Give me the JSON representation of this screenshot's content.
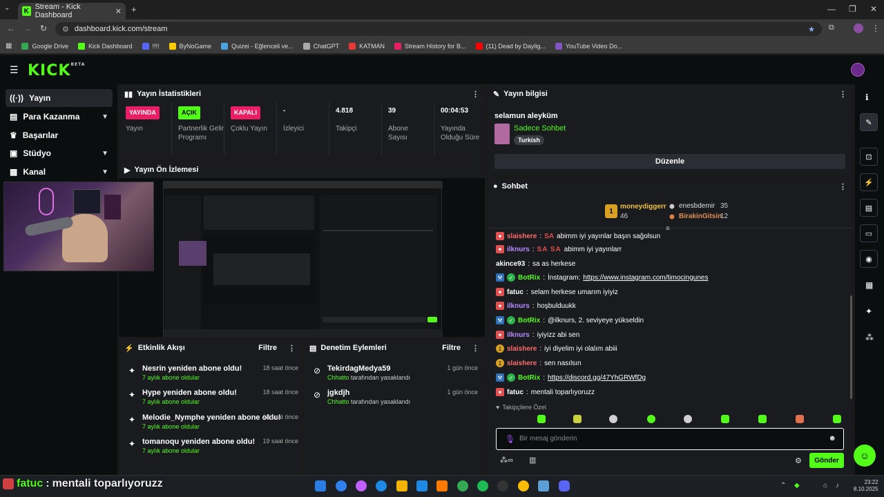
{
  "browser": {
    "tab_title": "Stream - Kick Dashboard",
    "url": "dashboard.kick.com/stream",
    "bookmarks": [
      {
        "label": "Google Drive",
        "color": "#34a853"
      },
      {
        "label": "Kick Dashboard",
        "color": "#53fc18"
      },
      {
        "label": "!!!!",
        "color": "#5865f2"
      },
      {
        "label": "ByNoGame",
        "color": "#ffcc00"
      },
      {
        "label": "Quizei - Eğlenceli ve...",
        "color": "#4aa3df"
      },
      {
        "label": "ChatGPT",
        "color": "#aaaaaa"
      },
      {
        "label": "KATMAN",
        "color": "#e53935"
      },
      {
        "label": "Stream History for B...",
        "color": "#e91e63"
      },
      {
        "label": "(11) Dead by Daylig...",
        "color": "#ff0000"
      },
      {
        "label": "YouTube Video Do...",
        "color": "#7e57c2"
      }
    ]
  },
  "header": {
    "logo": "KICK",
    "logo_sup": "BETA"
  },
  "sidebar": {
    "items": [
      {
        "label": "Yayın",
        "icon": "broadcast-icon"
      },
      {
        "label": "Para Kazanma",
        "icon": "wallet-icon"
      },
      {
        "label": "Başarılar",
        "icon": "trophy-icon"
      },
      {
        "label": "Stüdyo",
        "icon": "studio-icon"
      },
      {
        "label": "Kanal",
        "icon": "channel-icon"
      }
    ]
  },
  "stats": {
    "title": "Yayın İstatistikleri",
    "cols": [
      {
        "value": "YAYINDA",
        "label": "Yayın",
        "badge_color": "#e91e63"
      },
      {
        "value": "AÇIK",
        "label": "Partnerlik Gelir Programı",
        "badge_color": "#53fc18"
      },
      {
        "value": "KAPALI",
        "label": "Çoklu Yayın",
        "badge_color": "#e91e63"
      },
      {
        "value": "-",
        "label": "İzleyici"
      },
      {
        "value": "4.818",
        "label": "Takipçi"
      },
      {
        "value": "39",
        "label": "Abone Sayısı"
      },
      {
        "value": "00:04:53",
        "label": "Yayında Olduğu Süre"
      }
    ]
  },
  "preview": {
    "title": "Yayın Ön İzlemesi"
  },
  "info": {
    "title": "Yayın bilgisi",
    "stream_title": "selamun aleyküm",
    "category": "Sadece Sohbet",
    "tag": "Turkish",
    "edit_label": "Düzenle"
  },
  "events": {
    "title": "Etkinlik Akışı",
    "filter": "Filtre",
    "items": [
      {
        "title": "Nesrin yeniden abone oldu!",
        "sub": "7 aylık abone oldular",
        "time": "18 saat önce"
      },
      {
        "title": "Hype yeniden abone oldu!",
        "sub": "7 aylık abone oldular",
        "time": "18 saat önce"
      },
      {
        "title": "Melodie_Nymphe yeniden abone oldu!",
        "sub": "7 aylık abone oldular",
        "time": "18 saat önce"
      },
      {
        "title": "tomanoqu yeniden abone oldu!",
        "sub": "7 aylık abone oldular",
        "time": "19 saat önce"
      }
    ]
  },
  "mod": {
    "title": "Denetim Eylemleri",
    "filter": "Filtre",
    "items": [
      {
        "user": "TekirdagMedya59",
        "by": "Chhatto",
        "suffix": "tarafından yasaklandı",
        "time": "1 gün önce"
      },
      {
        "user": "jgkdjh",
        "by": "Chhatto",
        "suffix": "tarafından yasaklandı",
        "time": "1 gün önce"
      }
    ]
  },
  "chat": {
    "title": "Sohbet",
    "leaders": [
      {
        "name": "moneydiggerr",
        "count": "46"
      },
      {
        "name": "enesbdemir",
        "count": "35"
      },
      {
        "name": "BirakinGitsin",
        "count": "12"
      }
    ],
    "messages": [
      {
        "user": "slaishere",
        "color": "#ff6b6b",
        "text": "abimm iyi yayınlar başın sağolsun",
        "emote": "SA"
      },
      {
        "user": "ilknurs",
        "color": "#b68cff",
        "text": "abimm iyi yayınlarr",
        "emote": "SA SA"
      },
      {
        "user": "akince93",
        "color": "#fff",
        "text": "sa as herkese"
      },
      {
        "user": "BotRix",
        "color": "#53fc18",
        "text": "İnstagram:",
        "link": "https://www.instagram.com/timocingunes"
      },
      {
        "user": "fatuc",
        "color": "#fff",
        "text": "selam herkese umarım iyiyiz"
      },
      {
        "user": "ilknurs",
        "color": "#b68cff",
        "text": "hoşbulduukk"
      },
      {
        "user": "BotRix",
        "color": "#53fc18",
        "text": "@ilknurs, 2. seviyeye yükseldin"
      },
      {
        "user": "ilknurs",
        "color": "#b68cff",
        "text": "iyiyizz abi sen"
      },
      {
        "user": "slaishere",
        "color": "#ff6b6b",
        "text": "iyi diyelim iyi olalım abiii"
      },
      {
        "user": "slaishere",
        "color": "#ff6b6b",
        "text": "sen nasılsın"
      },
      {
        "user": "BotRix",
        "color": "#53fc18",
        "text": "",
        "link": "https://discord.gg/47YhGRWfDg"
      },
      {
        "user": "fatuc",
        "color": "#fff",
        "text": "mentali toparlıyoruzz"
      }
    ],
    "followers_only": "Takipçilere Özel",
    "input_placeholder": "Bir mesaj gönderin",
    "send_label": "Gönder"
  },
  "overlay": {
    "user": "fatuc",
    "text": "mentali toparlıyoruzz"
  },
  "clock": {
    "time": "23:22",
    "date": "8.10.2025"
  }
}
